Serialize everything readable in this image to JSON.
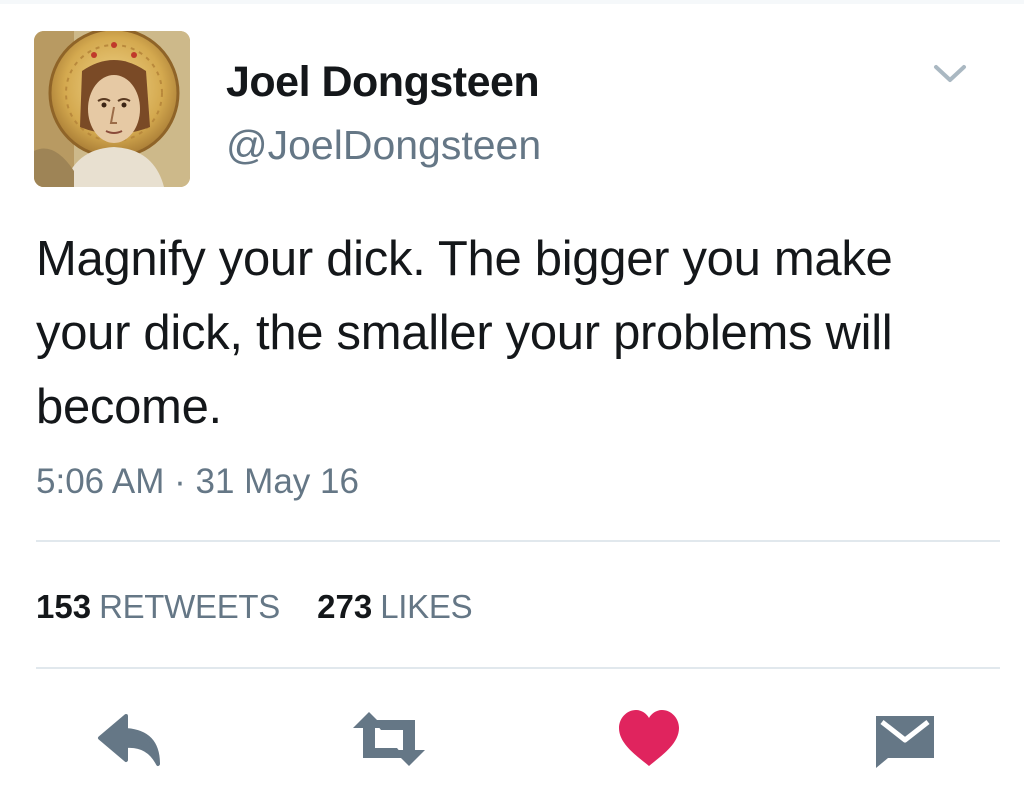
{
  "user": {
    "display_name": "Joel Dongsteen",
    "handle": "@JoelDongsteen",
    "avatar_description": "painted-saint-with-halo"
  },
  "tweet": {
    "text": "Magnify your dick. The bigger you make your dick, the smaller your problems will become.",
    "timestamp": "5:06 AM · 31 May 16"
  },
  "stats": {
    "retweets_count": "153",
    "retweets_label": "RETWEETS",
    "likes_count": "273",
    "likes_label": "LIKES"
  },
  "actions": {
    "reply_icon": "reply-icon",
    "retweet_icon": "retweet-icon",
    "like_icon": "heart-icon",
    "dm_icon": "envelope-icon"
  },
  "colors": {
    "text_primary": "#14171a",
    "text_secondary": "#657786",
    "divider": "#e1e8ed",
    "action_icon": "#657786",
    "like_active": "#e0245e"
  }
}
